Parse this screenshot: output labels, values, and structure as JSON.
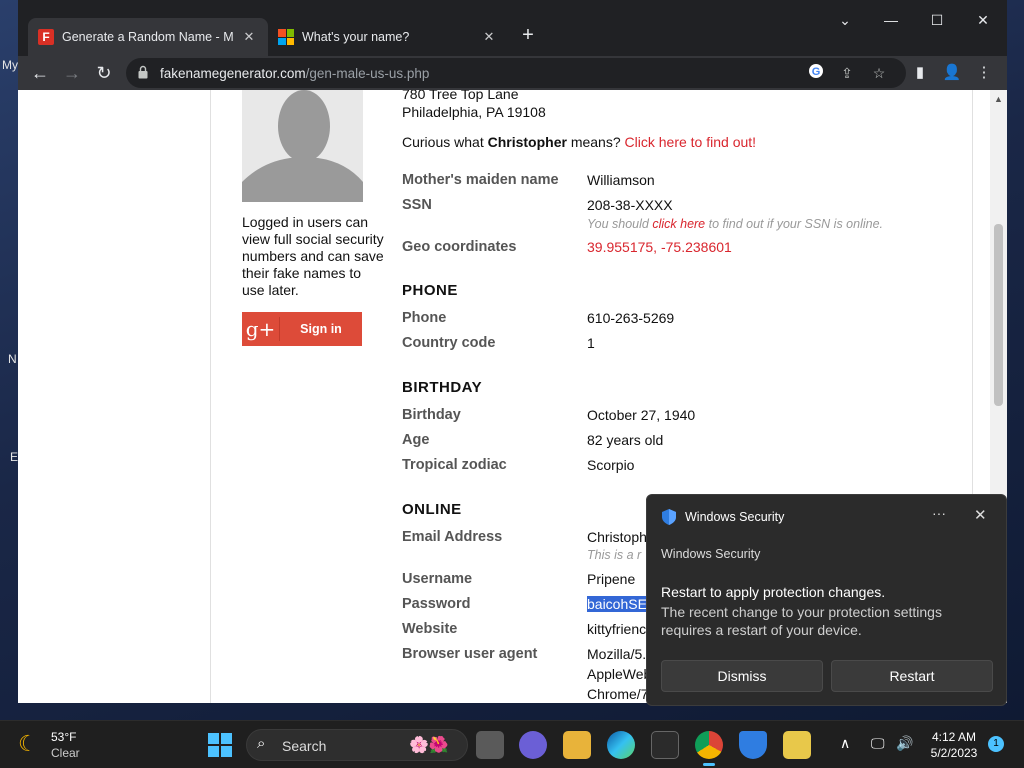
{
  "desktop": {
    "glyphs": [
      "My",
      "N",
      "E"
    ]
  },
  "browser": {
    "tabs": [
      {
        "title": "Generate a Random Name - Male",
        "favicon": "fakename-f-icon"
      },
      {
        "title": "What's your name?",
        "favicon": "microsoft-icon"
      }
    ],
    "url_host": "fakenamegenerator.com",
    "url_path": "/gen-male-us-us.php"
  },
  "page": {
    "address_line1": "780 Tree Top Lane",
    "address_line2": "Philadelphia, PA 19108",
    "curious_prefix": "Curious what ",
    "curious_name": "Christopher",
    "curious_suffix": " means? ",
    "curious_link": "Click here to find out!",
    "sidebar_text": "Logged in users can view full social security numbers and can save their fake names to use later.",
    "gplus_label": "Sign in",
    "gplus_glyph": "g+",
    "fields": {
      "mothers_maiden_label": "Mother's maiden name",
      "mothers_maiden": "Williamson",
      "ssn_label": "SSN",
      "ssn": "208-38-XXXX",
      "ssn_note_prefix": "You should ",
      "ssn_note_link": "click here",
      "ssn_note_suffix": " to find out if your SSN is online.",
      "geo_label": "Geo coordinates",
      "geo": "39.955175, -75.238601"
    },
    "phone_section": "PHONE",
    "phone_label": "Phone",
    "phone": "610-263-5269",
    "country_code_label": "Country code",
    "country_code": "1",
    "birthday_section": "BIRTHDAY",
    "birthday_label": "Birthday",
    "birthday": "October 27, 1940",
    "age_label": "Age",
    "age": "82 years old",
    "zodiac_label": "Tropical zodiac",
    "zodiac": "Scorpio",
    "online_section": "ONLINE",
    "email_label": "Email Address",
    "email_partial": "Christoph",
    "email_note_partial": "This is a r",
    "username_label": "Username",
    "username": "Pripene",
    "password_label": "Password",
    "password_partial": "baicohSE",
    "website_label": "Website",
    "website_partial": "kittyfrienc",
    "ua_label": "Browser user agent",
    "ua_line1": "Mozilla/5.",
    "ua_line2": "AppleWeb",
    "ua_line3": "Chrome/7"
  },
  "notification": {
    "app_name": "Windows Security",
    "source": "Windows Security",
    "title": "Restart to apply protection changes.",
    "body": "The recent change to your protection settings requires a restart of your device.",
    "more": "···",
    "dismiss": "Dismiss",
    "restart": "Restart"
  },
  "taskbar": {
    "temperature": "53°F",
    "condition": "Clear",
    "search_placeholder": "Search",
    "time": "4:12 AM",
    "date": "5/2/2023",
    "notification_count": "1"
  },
  "colors": {
    "link_red": "#d9262e",
    "gplus_red": "#dd4b39",
    "accent_blue": "#4cc2ff"
  }
}
